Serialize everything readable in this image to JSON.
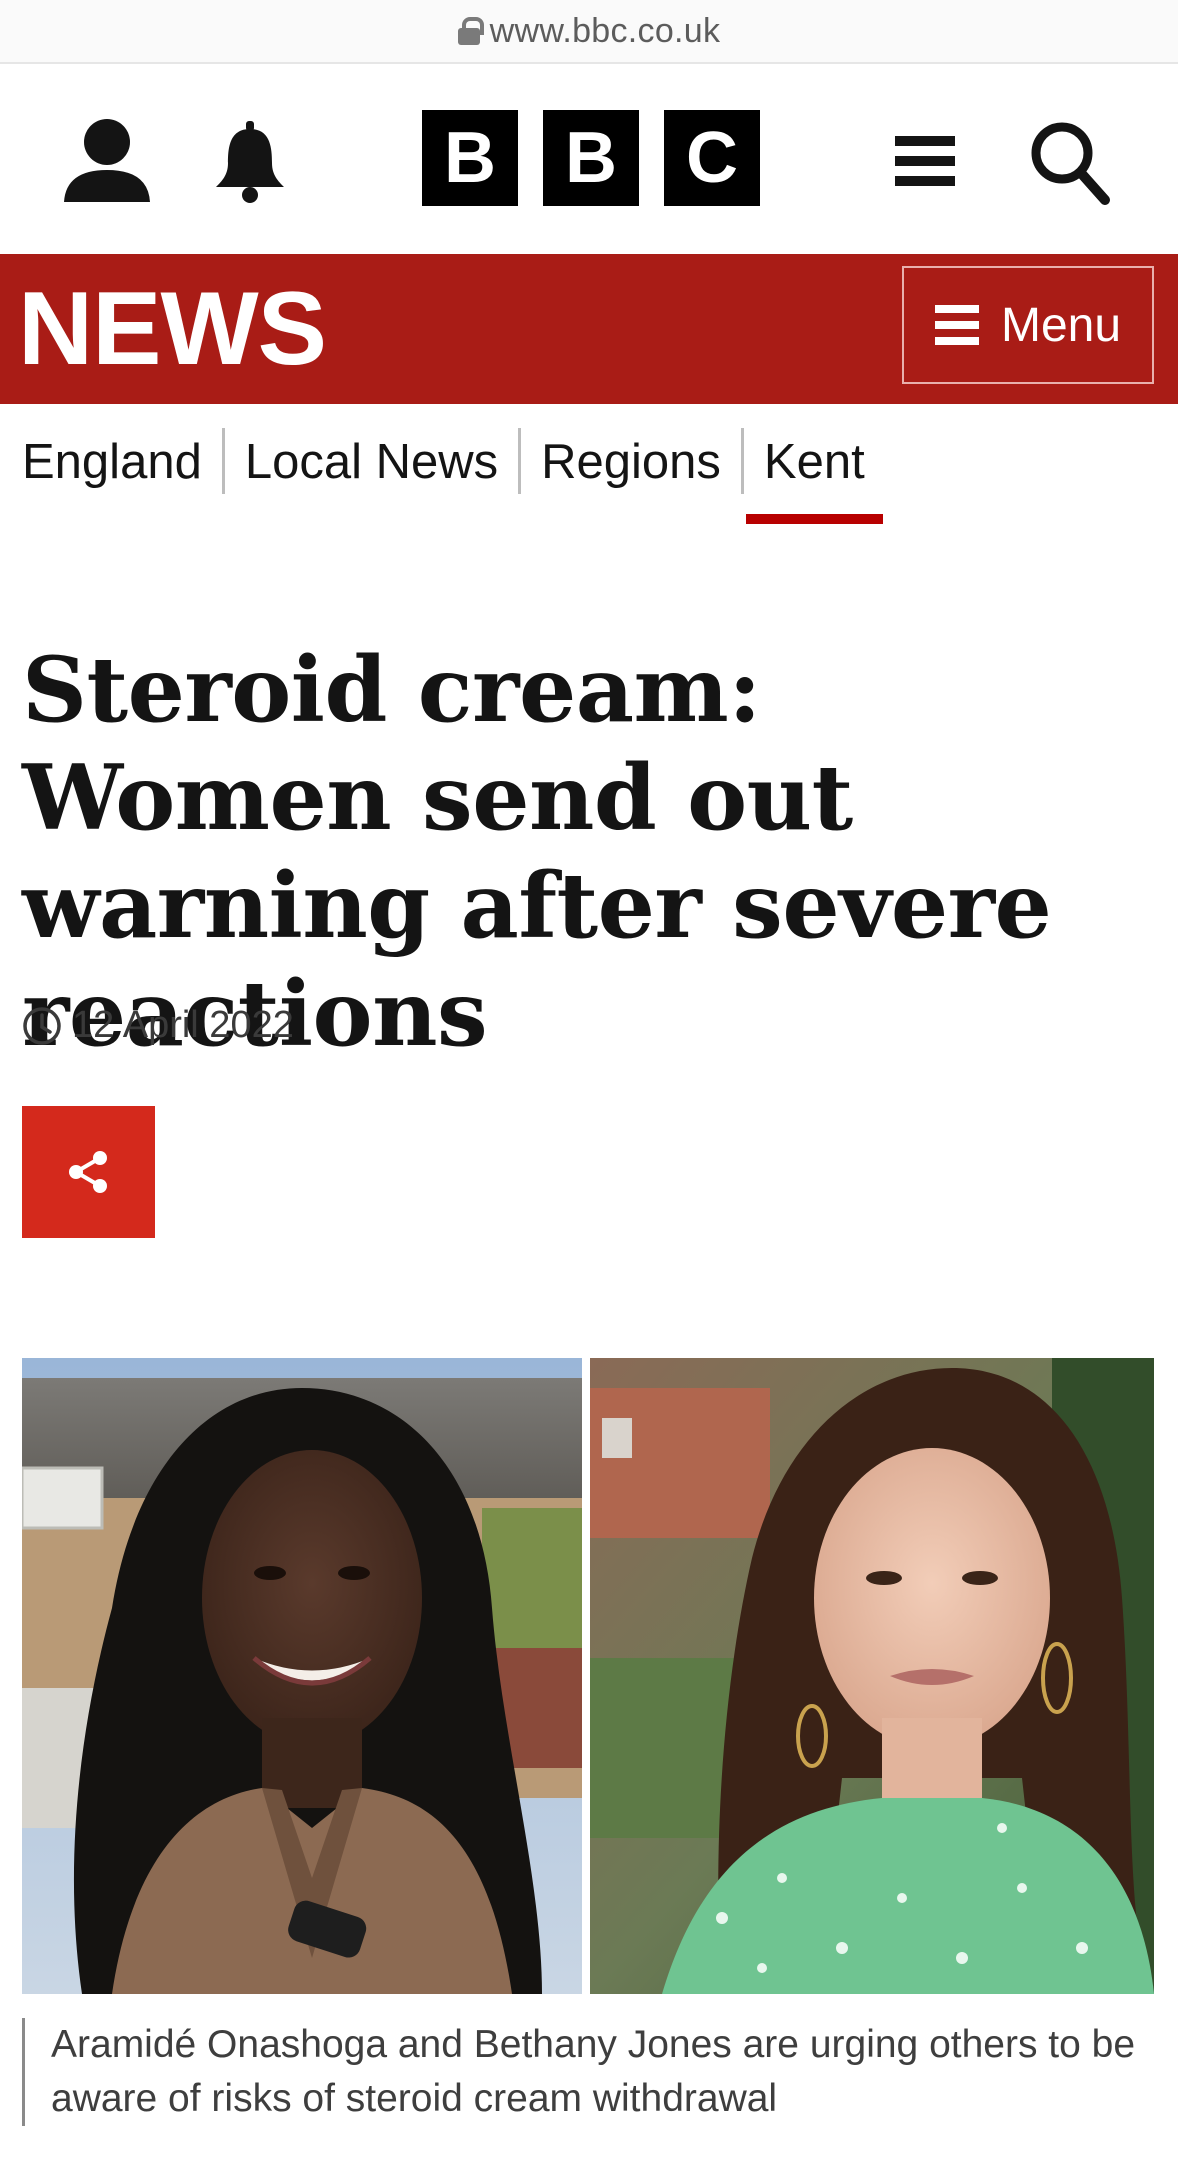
{
  "browser": {
    "url": "www.bbc.co.uk"
  },
  "header": {
    "logo_letters": [
      "B",
      "B",
      "C"
    ],
    "icons": [
      "account-icon",
      "notifications-icon",
      "menu-icon",
      "search-icon"
    ]
  },
  "newsbar": {
    "title": "NEWS",
    "menu_label": "Menu"
  },
  "subnav": {
    "items": [
      {
        "label": "England"
      },
      {
        "label": "Local News"
      },
      {
        "label": "Regions"
      },
      {
        "label": "Kent",
        "active": true
      }
    ]
  },
  "article": {
    "headline": "Steroid cream: Women send out warning after severe reactions",
    "date": "12 April 2022",
    "caption": "Aramidé Onashoga and Bethany Jones are urging others to be aware of risks of steroid cream withdrawal"
  },
  "colors": {
    "news_red": "#a91c16",
    "share_red": "#d4291c",
    "active_underline": "#b80000"
  }
}
